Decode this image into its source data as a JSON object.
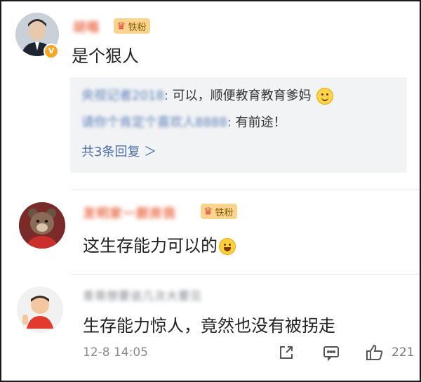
{
  "comments": [
    {
      "username": "胡唱",
      "fans_badge": "铁粉",
      "text": "是个狠人",
      "replies": [
        {
          "user": "央视记者2018",
          "colon": ":",
          "text": " 可以，顺便教育教育爹妈"
        },
        {
          "user": "请你个肯定个喜欢人8888",
          "colon": ":",
          "text": " 有前途！"
        }
      ],
      "more_replies": "共3条回复 ＞"
    },
    {
      "username": "发明家一厨房我",
      "fans_badge": "铁粉",
      "text": "这生存能力可以的"
    },
    {
      "username": "青哥想要说几次大要见",
      "text": "生存能力惊人，竟然也没有被拐走"
    }
  ],
  "footer": {
    "timestamp": "12-8 14:05",
    "like_count": "221"
  },
  "icons": {
    "share": "share-icon",
    "comment": "comment-icon",
    "like": "thumbs-up-icon",
    "verified": "verified-badge-icon",
    "crown": "crown-icon"
  },
  "colors": {
    "username": "#eb7350",
    "reply_link": "#4b6fa8",
    "reply_bg": "#f2f3f5",
    "badge_bg": "#f8d48f"
  }
}
